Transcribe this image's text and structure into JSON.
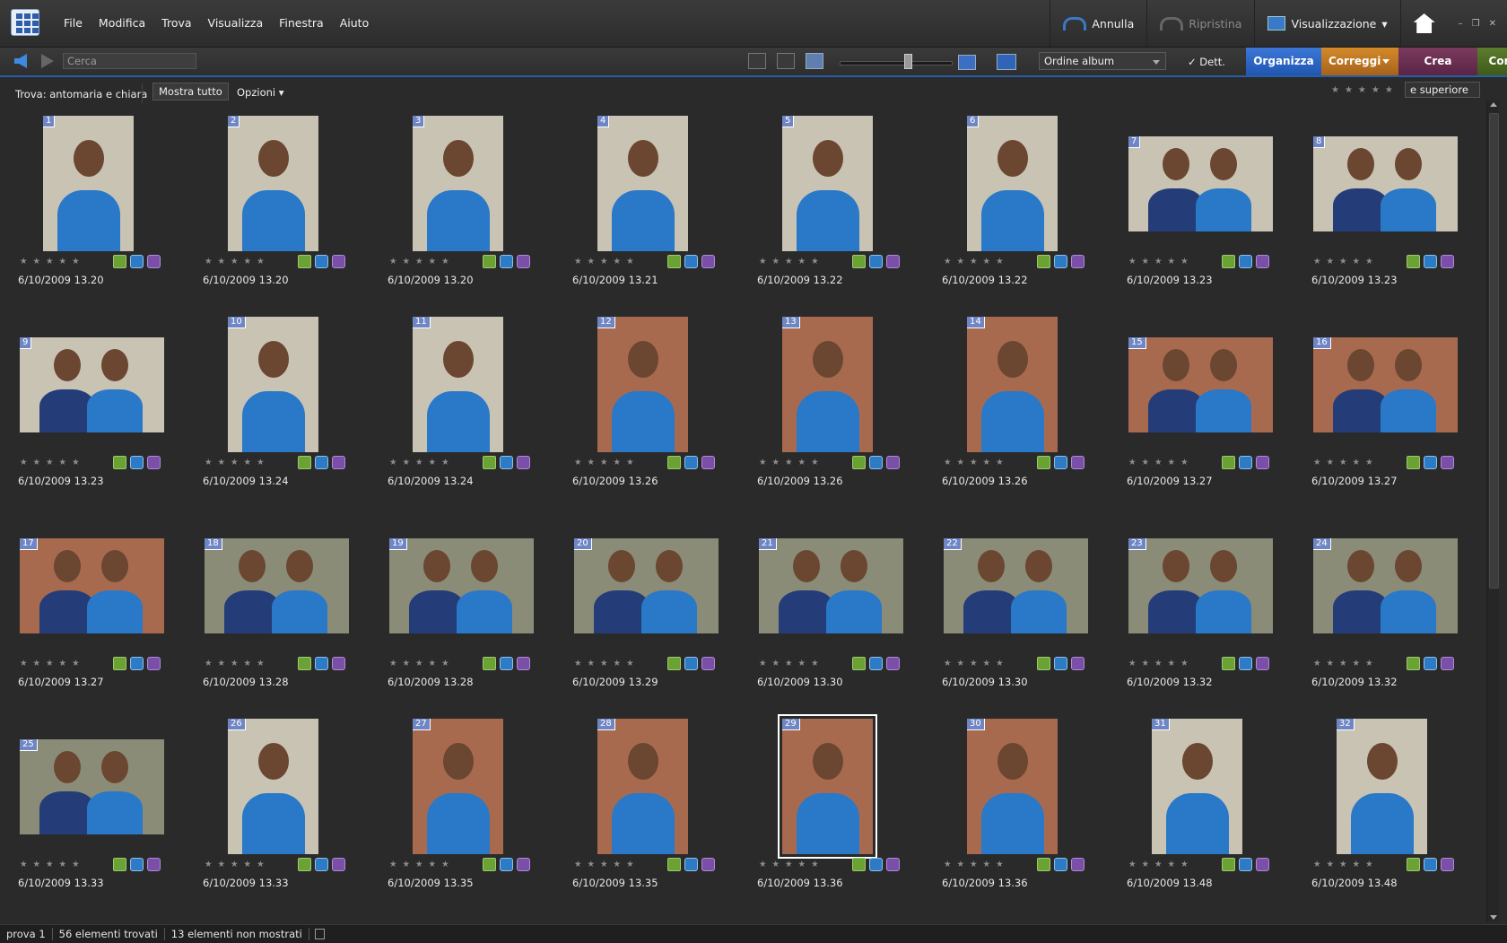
{
  "menu": {
    "items": [
      "File",
      "Modifica",
      "Trova",
      "Visualizza",
      "Finestra",
      "Aiuto"
    ]
  },
  "top_right": {
    "undo": "Annulla",
    "redo": "Ripristina",
    "view": "Visualizzazione",
    "view_arrow": "▾"
  },
  "toolbar": {
    "search_placeholder": "Cerca",
    "sort": "Ordine album",
    "details_check": "✓",
    "details": "Dett."
  },
  "modes": {
    "organizza": "Organizza",
    "correggi": "Correggi",
    "crea": "Crea",
    "condividi": "Condividi"
  },
  "find": {
    "label": "Trova: antomaria e chiara",
    "show_all": "Mostra tutto",
    "options": "Opzioni ▾",
    "rating_filter": "★★★★★",
    "rating_mode": "e superiore"
  },
  "colors": {
    "organizza": "#2a64c0",
    "correggi": "#c07a24",
    "crea": "#6a2e52",
    "condividi": "#4d6c22",
    "thumb_number": "#6f86c4"
  },
  "photos": [
    {
      "num": "1",
      "date": "6/10/2009 13.20",
      "orient": "portrait"
    },
    {
      "num": "2",
      "date": "6/10/2009 13.20",
      "orient": "portrait"
    },
    {
      "num": "3",
      "date": "6/10/2009 13.20",
      "orient": "portrait"
    },
    {
      "num": "4",
      "date": "6/10/2009 13.21",
      "orient": "portrait"
    },
    {
      "num": "5",
      "date": "6/10/2009 13.22",
      "orient": "portrait"
    },
    {
      "num": "6",
      "date": "6/10/2009 13.22",
      "orient": "portrait"
    },
    {
      "num": "7",
      "date": "6/10/2009 13.23",
      "orient": "landscape"
    },
    {
      "num": "8",
      "date": "6/10/2009 13.23",
      "orient": "landscape"
    },
    {
      "num": "9",
      "date": "6/10/2009 13.23",
      "orient": "landscape"
    },
    {
      "num": "10",
      "date": "6/10/2009 13.24",
      "orient": "portrait"
    },
    {
      "num": "11",
      "date": "6/10/2009 13.24",
      "orient": "portrait"
    },
    {
      "num": "12",
      "date": "6/10/2009 13.26",
      "orient": "portrait"
    },
    {
      "num": "13",
      "date": "6/10/2009 13.26",
      "orient": "portrait"
    },
    {
      "num": "14",
      "date": "6/10/2009 13.26",
      "orient": "portrait"
    },
    {
      "num": "15",
      "date": "6/10/2009 13.27",
      "orient": "landscape"
    },
    {
      "num": "16",
      "date": "6/10/2009 13.27",
      "orient": "landscape"
    },
    {
      "num": "17",
      "date": "6/10/2009 13.27",
      "orient": "landscape"
    },
    {
      "num": "18",
      "date": "6/10/2009 13.28",
      "orient": "landscape"
    },
    {
      "num": "19",
      "date": "6/10/2009 13.28",
      "orient": "landscape"
    },
    {
      "num": "20",
      "date": "6/10/2009 13.29",
      "orient": "landscape"
    },
    {
      "num": "21",
      "date": "6/10/2009 13.30",
      "orient": "landscape"
    },
    {
      "num": "22",
      "date": "6/10/2009 13.30",
      "orient": "landscape"
    },
    {
      "num": "23",
      "date": "6/10/2009 13.32",
      "orient": "landscape"
    },
    {
      "num": "24",
      "date": "6/10/2009 13.32",
      "orient": "landscape"
    },
    {
      "num": "25",
      "date": "6/10/2009 13.33",
      "orient": "landscape"
    },
    {
      "num": "26",
      "date": "6/10/2009 13.33",
      "orient": "portrait"
    },
    {
      "num": "27",
      "date": "6/10/2009 13.35",
      "orient": "portrait"
    },
    {
      "num": "28",
      "date": "6/10/2009 13.35",
      "orient": "portrait"
    },
    {
      "num": "29",
      "date": "6/10/2009 13.36",
      "orient": "portrait",
      "selected": true
    },
    {
      "num": "30",
      "date": "6/10/2009 13.36",
      "orient": "portrait"
    },
    {
      "num": "31",
      "date": "6/10/2009 13.48",
      "orient": "portrait"
    },
    {
      "num": "32",
      "date": "6/10/2009 13.48",
      "orient": "portrait"
    }
  ],
  "thumb_stars": "★★★★★",
  "status": {
    "album": "prova 1",
    "found": "56 elementi trovati",
    "hidden": "13 elementi non mostrati"
  }
}
